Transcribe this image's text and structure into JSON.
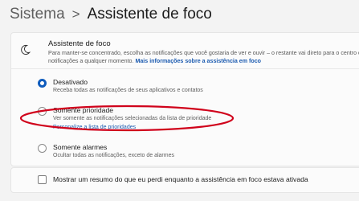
{
  "breadcrumb": {
    "parent": "Sistema",
    "separator": ">",
    "current": "Assistente de foco"
  },
  "header": {
    "title": "Assistente de foco",
    "description": "Para manter-se concentrado, escolha as notificações que você gostaria de ver e ouvir – o restante vai direto para o centro de notificações a qualquer momento.",
    "link": "Mais informações sobre a assistência em foco",
    "icon": "moon-icon"
  },
  "options": [
    {
      "label": "Desativado",
      "desc": "Receba todas as notificações de seus aplicativos e contatos",
      "selected": true
    },
    {
      "label": "Somente prioridade",
      "desc": "Ver somente as notificações selecionadas da lista de prioridade",
      "link": "Personalize a lista de prioridades",
      "selected": false
    },
    {
      "label": "Somente alarmes",
      "desc": "Ocultar todas as notificações, exceto de alarmes",
      "selected": false
    }
  ],
  "summary_checkbox": {
    "label": "Mostrar um resumo do que eu perdi enquanto a assistência em foco estava ativada",
    "checked": false
  },
  "colors": {
    "accent": "#0f5cbd",
    "annotation": "#d0021b"
  }
}
